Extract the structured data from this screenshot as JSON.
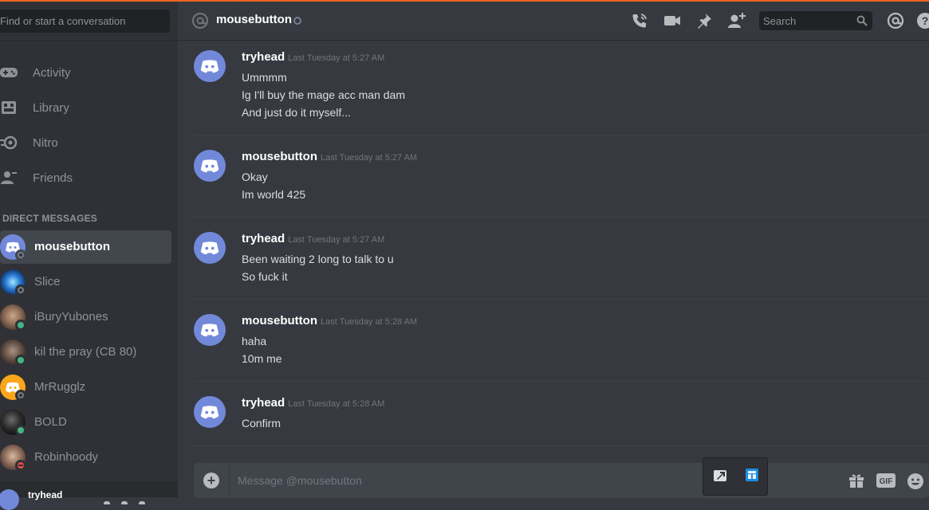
{
  "sidebar": {
    "search_placeholder": "Find or start a conversation",
    "nav": [
      {
        "label": "Activity",
        "icon": "gamepad-icon"
      },
      {
        "label": "Library",
        "icon": "library-icon"
      },
      {
        "label": "Nitro",
        "icon": "nitro-icon"
      },
      {
        "label": "Friends",
        "icon": "friends-icon"
      }
    ],
    "dm_header": "DIRECT MESSAGES",
    "dms": [
      {
        "name": "mousebutton",
        "status": "offline",
        "active": true
      },
      {
        "name": "Slice",
        "status": "offline"
      },
      {
        "name": "iBuryYubones",
        "status": "online"
      },
      {
        "name": "kil the pray (CB 80)",
        "status": "online"
      },
      {
        "name": "MrRugglz",
        "status": "offline"
      },
      {
        "name": "BOLD",
        "status": "online"
      },
      {
        "name": "Robinhoody",
        "status": "dnd"
      }
    ],
    "user": {
      "name": "tryhead"
    }
  },
  "header": {
    "title": "mousebutton",
    "search_placeholder": "Search"
  },
  "messages": [
    {
      "author": "tryhead",
      "timestamp": "Last Tuesday at 5:27 AM",
      "lines": [
        "Ummmm",
        "Ig I'll buy the mage acc man dam",
        "And just do it myself..."
      ]
    },
    {
      "author": "mousebutton",
      "timestamp": "Last Tuesday at 5:27 AM",
      "lines": [
        "Okay",
        "Im world 425"
      ]
    },
    {
      "author": "tryhead",
      "timestamp": "Last Tuesday at 5:27 AM",
      "lines": [
        "Been waiting 2 long to talk to u",
        "So fuck it"
      ]
    },
    {
      "author": "mousebutton",
      "timestamp": "Last Tuesday at 5:28 AM",
      "lines": [
        "haha",
        "10m me"
      ]
    },
    {
      "author": "tryhead",
      "timestamp": "Last Tuesday at 5:28 AM",
      "lines": [
        "Confirm"
      ]
    }
  ],
  "composer": {
    "placeholder": "Message @mousebutton",
    "gif_label": "GIF"
  },
  "colors": {
    "accent_top": "#f26522",
    "blurple": "#7289da",
    "online": "#43b581",
    "dnd": "#f04747",
    "offline": "#747f8d"
  }
}
